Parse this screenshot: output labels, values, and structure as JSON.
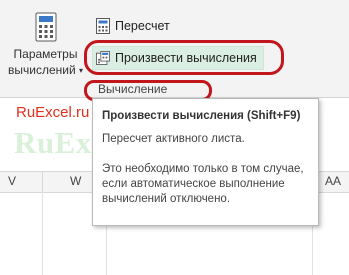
{
  "ribbon": {
    "calc_options": {
      "line1": "Параметры",
      "line2": "вычислений"
    },
    "recalculate": {
      "label": "Пересчет"
    },
    "calculate_now": {
      "label": "Произвести вычисления"
    },
    "group_label": "Вычисление"
  },
  "brand": "RuExcel.ru",
  "watermark": "RuExcel.ru",
  "columns": [
    "V",
    "W",
    "AA"
  ],
  "tooltip": {
    "title": "Произвести вычисления (Shift+F9)",
    "description": "Пересчет активного листа.",
    "note": "Это необходимо только в том случае, если автоматическое выполнение вычислений отключено."
  },
  "colors": {
    "highlight": "#c0161c",
    "brand": "#e0301e",
    "active_button": "#dbeee3"
  }
}
